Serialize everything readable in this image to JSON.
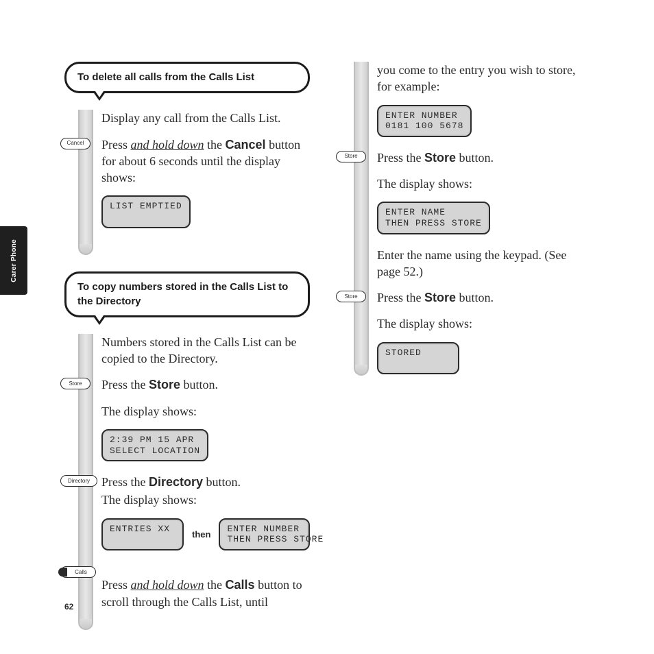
{
  "sidetab": "Carer Phone",
  "page_number": "62",
  "left": {
    "callout1": "To delete all calls from the Calls List",
    "p1": "Display any call from the Calls List.",
    "btn_cancel": "Cancel",
    "p2a": "Press ",
    "p2_u": "and hold down",
    "p2b": " the ",
    "p2_bold": "Cancel",
    "p2c": " button for about 6 seconds until the display shows:",
    "lcd1": "LIST EMPTIED",
    "callout2": "To copy numbers stored in the Calls List to the Directory",
    "p3": "Numbers stored in the Calls List can be copied to the Directory.",
    "btn_store": "Store",
    "p4a": "Press the ",
    "p4_bold": "Store",
    "p4b": " button.",
    "p5": "The display shows:",
    "lcd2_l1": "2:39 PM 15 APR",
    "lcd2_l2": "SELECT LOCATION",
    "btn_directory": "Directory",
    "p6a": "Press the ",
    "p6_bold": "Directory",
    "p6b": " button.",
    "p7": "The display shows:",
    "lcd3": "ENTRIES XX",
    "then": "then",
    "lcd4_l1": "ENTER NUMBER",
    "lcd4_l2": "THEN PRESS STORE",
    "btn_calls": "Calls",
    "p8a": "Press ",
    "p8_u": "and hold down",
    "p8b": " the ",
    "p8_bold": "Calls",
    "p8c": " button to scroll through the Calls List, until"
  },
  "right": {
    "p1": "you come to the entry you wish to store, for example:",
    "lcd1_l1": "ENTER NUMBER",
    "lcd1_l2": "0181 100 5678",
    "btn_store": "Store",
    "p2a": "Press the ",
    "p2_bold": "Store",
    "p2b": " button.",
    "p3": "The display shows:",
    "lcd2_l1": "ENTER NAME",
    "lcd2_l2": "THEN PRESS STORE",
    "p4": "Enter the name using the keypad. (See page 52.)",
    "p5a": "Press the ",
    "p5_bold": "Store",
    "p5b": " button.",
    "p6": "The display shows:",
    "lcd3": "STORED"
  }
}
